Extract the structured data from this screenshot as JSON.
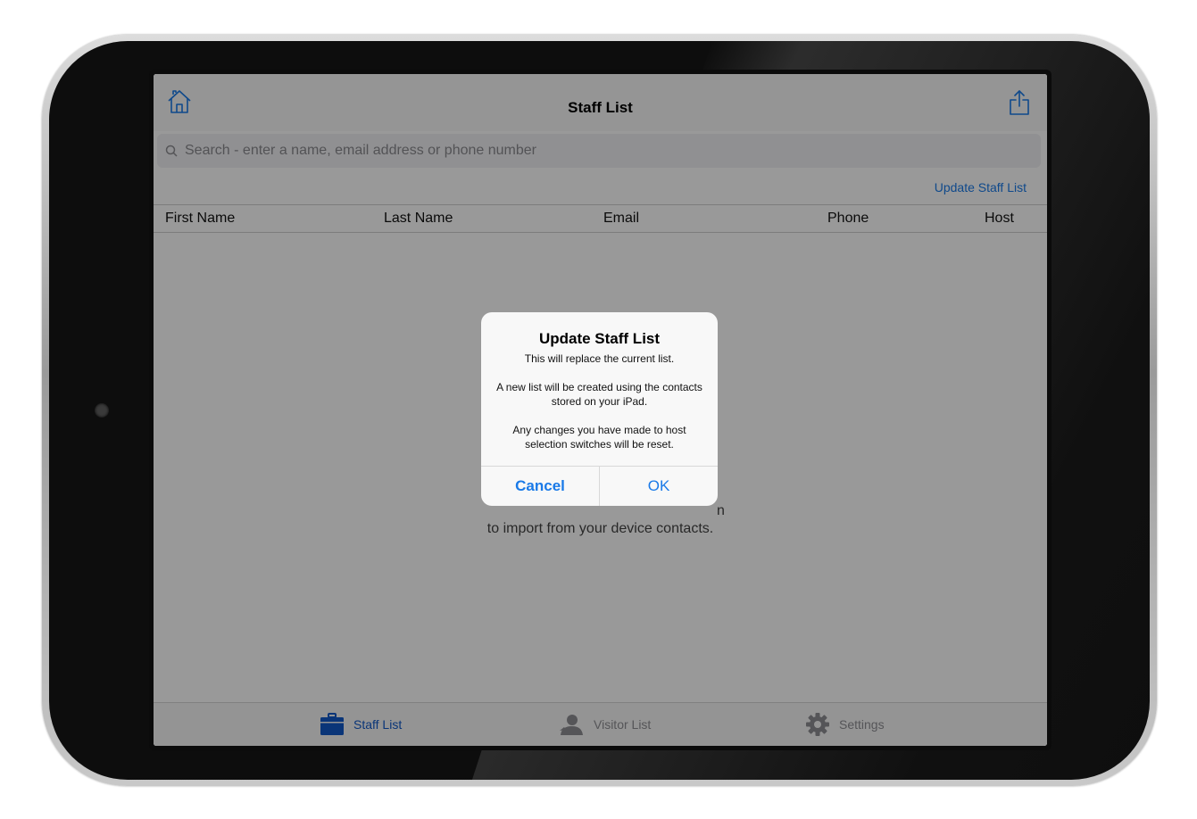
{
  "nav": {
    "title": "Staff List",
    "home_icon": "home-icon",
    "share_icon": "share-icon"
  },
  "search": {
    "placeholder": "Search - enter a name, email address or phone number",
    "value": ""
  },
  "update_link": "Update Staff List",
  "table": {
    "columns": [
      "First Name",
      "Last Name",
      "Email",
      "Phone",
      "Host"
    ]
  },
  "empty_message": {
    "line1": "n",
    "line2": "to import from your device contacts."
  },
  "tabs": [
    {
      "label": "Staff List",
      "icon": "briefcase-icon",
      "active": true
    },
    {
      "label": "Visitor List",
      "icon": "person-icon",
      "active": false
    },
    {
      "label": "Settings",
      "icon": "gear-icon",
      "active": false
    }
  ],
  "alert": {
    "title": "Update Staff List",
    "message": "This will replace the current list.\n\nA new list will be created using the contacts stored on your iPad.\n\nAny changes you have made to host selection switches will be reset.",
    "cancel": "Cancel",
    "ok": "OK"
  },
  "colors": {
    "accent": "#1a7ae8",
    "tab_active": "#1259c8",
    "tab_inactive": "#8e8e93"
  }
}
